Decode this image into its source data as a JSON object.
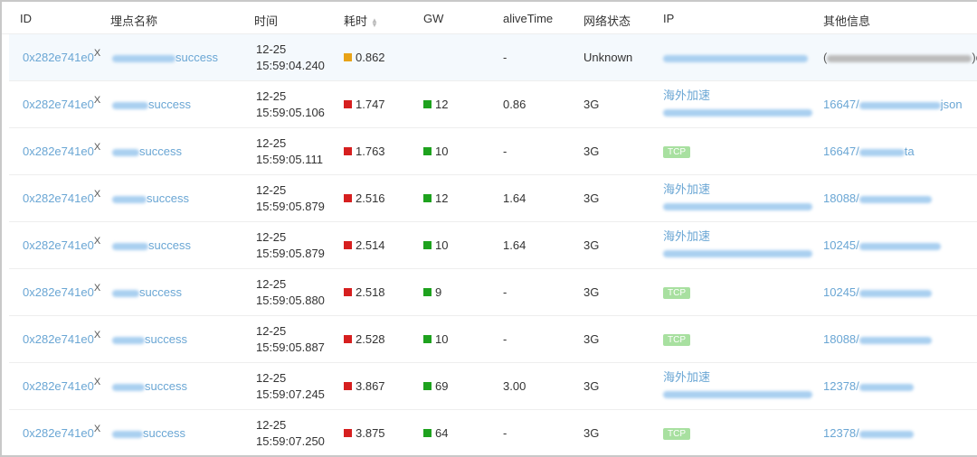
{
  "headers": [
    "ID",
    "埋点名称",
    "时间",
    "耗时",
    "GW",
    "aliveTime",
    "网络状态",
    "IP",
    "其他信息"
  ],
  "colors": {
    "orange": "#e8a317",
    "red": "#d61f1f",
    "green": "#1ea21e",
    "link": "#6aa6d4",
    "tcp": "#a8e0a0"
  },
  "rows": [
    {
      "id": "0x282e741e0",
      "x": "X",
      "name": "success",
      "date": "12-25",
      "time": "15:59:04.240",
      "cost": "0.862",
      "cost_color": "orange",
      "gw": "",
      "alive": "-",
      "net": "Unknown",
      "ip_label": "",
      "ip_tcp": false,
      "other_prefix": "(",
      "other_suffix": ")c"
    },
    {
      "id": "0x282e741e0",
      "x": "X",
      "name": "success",
      "date": "12-25",
      "time": "15:59:05.106",
      "cost": "1.747",
      "cost_color": "red",
      "gw": "12",
      "alive": "0.86",
      "net": "3G",
      "ip_label": "海外加速",
      "ip_tcp": false,
      "other_prefix": "16647/",
      "other_suffix": "json"
    },
    {
      "id": "0x282e741e0",
      "x": "X",
      "name": "success",
      "date": "12-25",
      "time": "15:59:05.111",
      "cost": "1.763",
      "cost_color": "red",
      "gw": "10",
      "alive": "-",
      "net": "3G",
      "ip_label": "TCP",
      "ip_tcp": true,
      "other_prefix": "16647/",
      "other_suffix": "ta"
    },
    {
      "id": "0x282e741e0",
      "x": "X",
      "name": "success",
      "date": "12-25",
      "time": "15:59:05.879",
      "cost": "2.516",
      "cost_color": "red",
      "gw": "12",
      "alive": "1.64",
      "net": "3G",
      "ip_label": "海外加速",
      "ip_tcp": false,
      "other_prefix": "18088/",
      "other_suffix": ""
    },
    {
      "id": "0x282e741e0",
      "x": "X",
      "name": "success",
      "date": "12-25",
      "time": "15:59:05.879",
      "cost": "2.514",
      "cost_color": "red",
      "gw": "10",
      "alive": "1.64",
      "net": "3G",
      "ip_label": "海外加速",
      "ip_tcp": false,
      "other_prefix": "10245/",
      "other_suffix": ""
    },
    {
      "id": "0x282e741e0",
      "x": "X",
      "name": "success",
      "date": "12-25",
      "time": "15:59:05.880",
      "cost": "2.518",
      "cost_color": "red",
      "gw": "9",
      "alive": "-",
      "net": "3G",
      "ip_label": "TCP",
      "ip_tcp": true,
      "other_prefix": "10245/",
      "other_suffix": ""
    },
    {
      "id": "0x282e741e0",
      "x": "X",
      "name": "success",
      "date": "12-25",
      "time": "15:59:05.887",
      "cost": "2.528",
      "cost_color": "red",
      "gw": "10",
      "alive": "-",
      "net": "3G",
      "ip_label": "TCP",
      "ip_tcp": true,
      "other_prefix": "18088/",
      "other_suffix": ""
    },
    {
      "id": "0x282e741e0",
      "x": "X",
      "name": "success",
      "date": "12-25",
      "time": "15:59:07.245",
      "cost": "3.867",
      "cost_color": "red",
      "gw": "69",
      "alive": "3.00",
      "net": "3G",
      "ip_label": "海外加速",
      "ip_tcp": false,
      "other_prefix": "12378/",
      "other_suffix": ""
    },
    {
      "id": "0x282e741e0",
      "x": "X",
      "name": "success",
      "date": "12-25",
      "time": "15:59:07.250",
      "cost": "3.875",
      "cost_color": "red",
      "gw": "64",
      "alive": "-",
      "net": "3G",
      "ip_label": "TCP",
      "ip_tcp": true,
      "other_prefix": "12378/",
      "other_suffix": ""
    }
  ]
}
